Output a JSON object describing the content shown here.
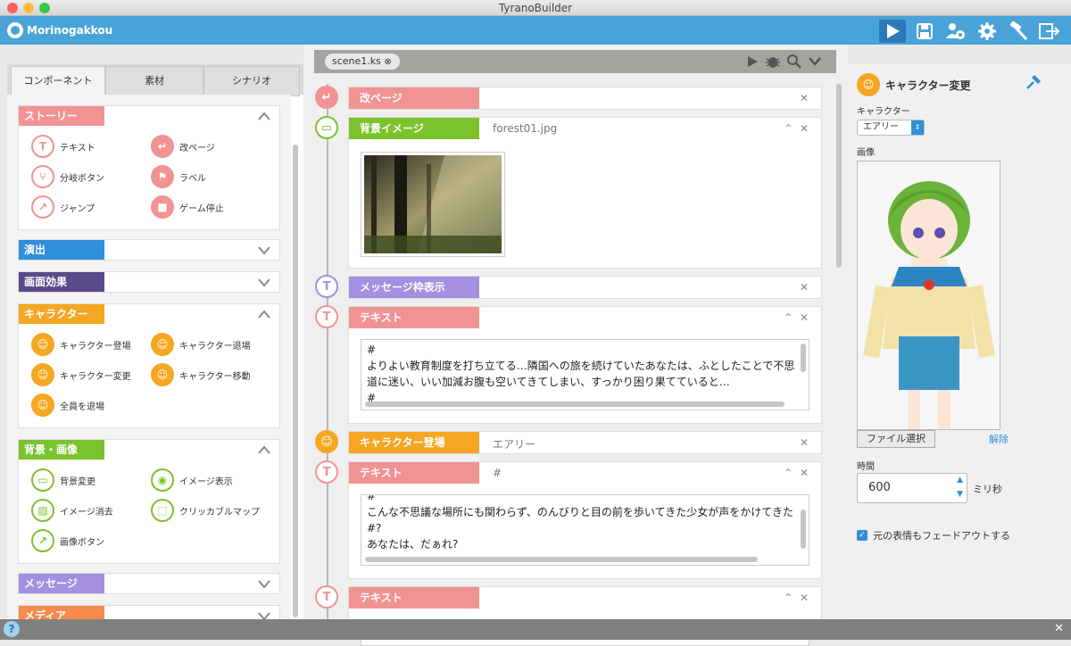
{
  "window": {
    "title": "TyranoBuilder"
  },
  "app": {
    "brand": "Morinogakkou"
  },
  "toolbar": {
    "icons": [
      "play-icon",
      "save-icon",
      "users-gear-icon",
      "gear-icon",
      "hammer-icon",
      "export-icon"
    ]
  },
  "left_panel": {
    "tabs": [
      "コンポーネント",
      "素材",
      "シナリオ"
    ],
    "categories": [
      {
        "label": "ストーリー",
        "color": "#f29393",
        "expanded": true,
        "items": [
          "テキスト",
          "改ページ",
          "分岐ボタン",
          "ラベル",
          "ジャンプ",
          "ゲーム停止"
        ]
      },
      {
        "label": "演出",
        "color": "#2f8fd8",
        "expanded": false
      },
      {
        "label": "画面効果",
        "color": "#5a4a8a",
        "expanded": false
      },
      {
        "label": "キャラクター",
        "color": "#f5a623",
        "expanded": true,
        "items": [
          "キャラクター登場",
          "キャラクター退場",
          "キャラクター変更",
          "キャラクター移動",
          "全員を退場"
        ]
      },
      {
        "label": "背景・画像",
        "color": "#7cc22d",
        "expanded": true,
        "items": [
          "背景変更",
          "イメージ表示",
          "イメージ消去",
          "クリッカブルマップ",
          "画像ボタン"
        ]
      },
      {
        "label": "メッセージ",
        "color": "#a58fe0",
        "expanded": false
      },
      {
        "label": "メディア",
        "color": "#f58b4c",
        "expanded": false
      }
    ]
  },
  "editor": {
    "tab_label": "scene1.ks",
    "events": [
      {
        "label": "改ページ",
        "color": "#f29393",
        "value": ""
      },
      {
        "label": "背景イメージ",
        "color": "#7cc22d",
        "value": "forest01.jpg"
      },
      {
        "label": "メッセージ枠表示",
        "color": "#a58fe0",
        "value": ""
      },
      {
        "label": "テキスト",
        "color": "#f29393",
        "value": "",
        "lines": [
          "#",
          "よりよい教育制度を打ち立てる…隣国への旅を続けていたあなたは、ふとしたことで不思",
          "道に迷い、いい加減お腹も空いてきてしまい、すっかり困り果てていると…",
          "#"
        ]
      },
      {
        "label": "キャラクター登場",
        "color": "#f5a623",
        "value": "エアリー"
      },
      {
        "label": "テキスト",
        "color": "#f29393",
        "value": "#",
        "lines": [
          "#",
          "こんな不思議な場所にも関わらず、のんびりと目の前を歩いてきた少女が声をかけてきた",
          "#?",
          "あなたは、だぁれ?"
        ]
      },
      {
        "label": "テキスト",
        "color": "#f29393",
        "value": "",
        "lines": [
          "#"
        ]
      }
    ]
  },
  "right_panel": {
    "title": "キャラクター変更",
    "character_label": "キャラクター",
    "character_value": "エアリー",
    "image_label": "画像",
    "file_button": "ファイル選択",
    "release_link": "解除",
    "time_label": "時間",
    "time_value": "600",
    "time_unit": "ミリ秒",
    "fade_label": "元の表情もフェードアウトする",
    "fade_checked": true
  },
  "colors": {
    "accent": "#4aa3d8",
    "story": "#f29393",
    "character": "#f5a623",
    "background": "#7cc22d"
  }
}
